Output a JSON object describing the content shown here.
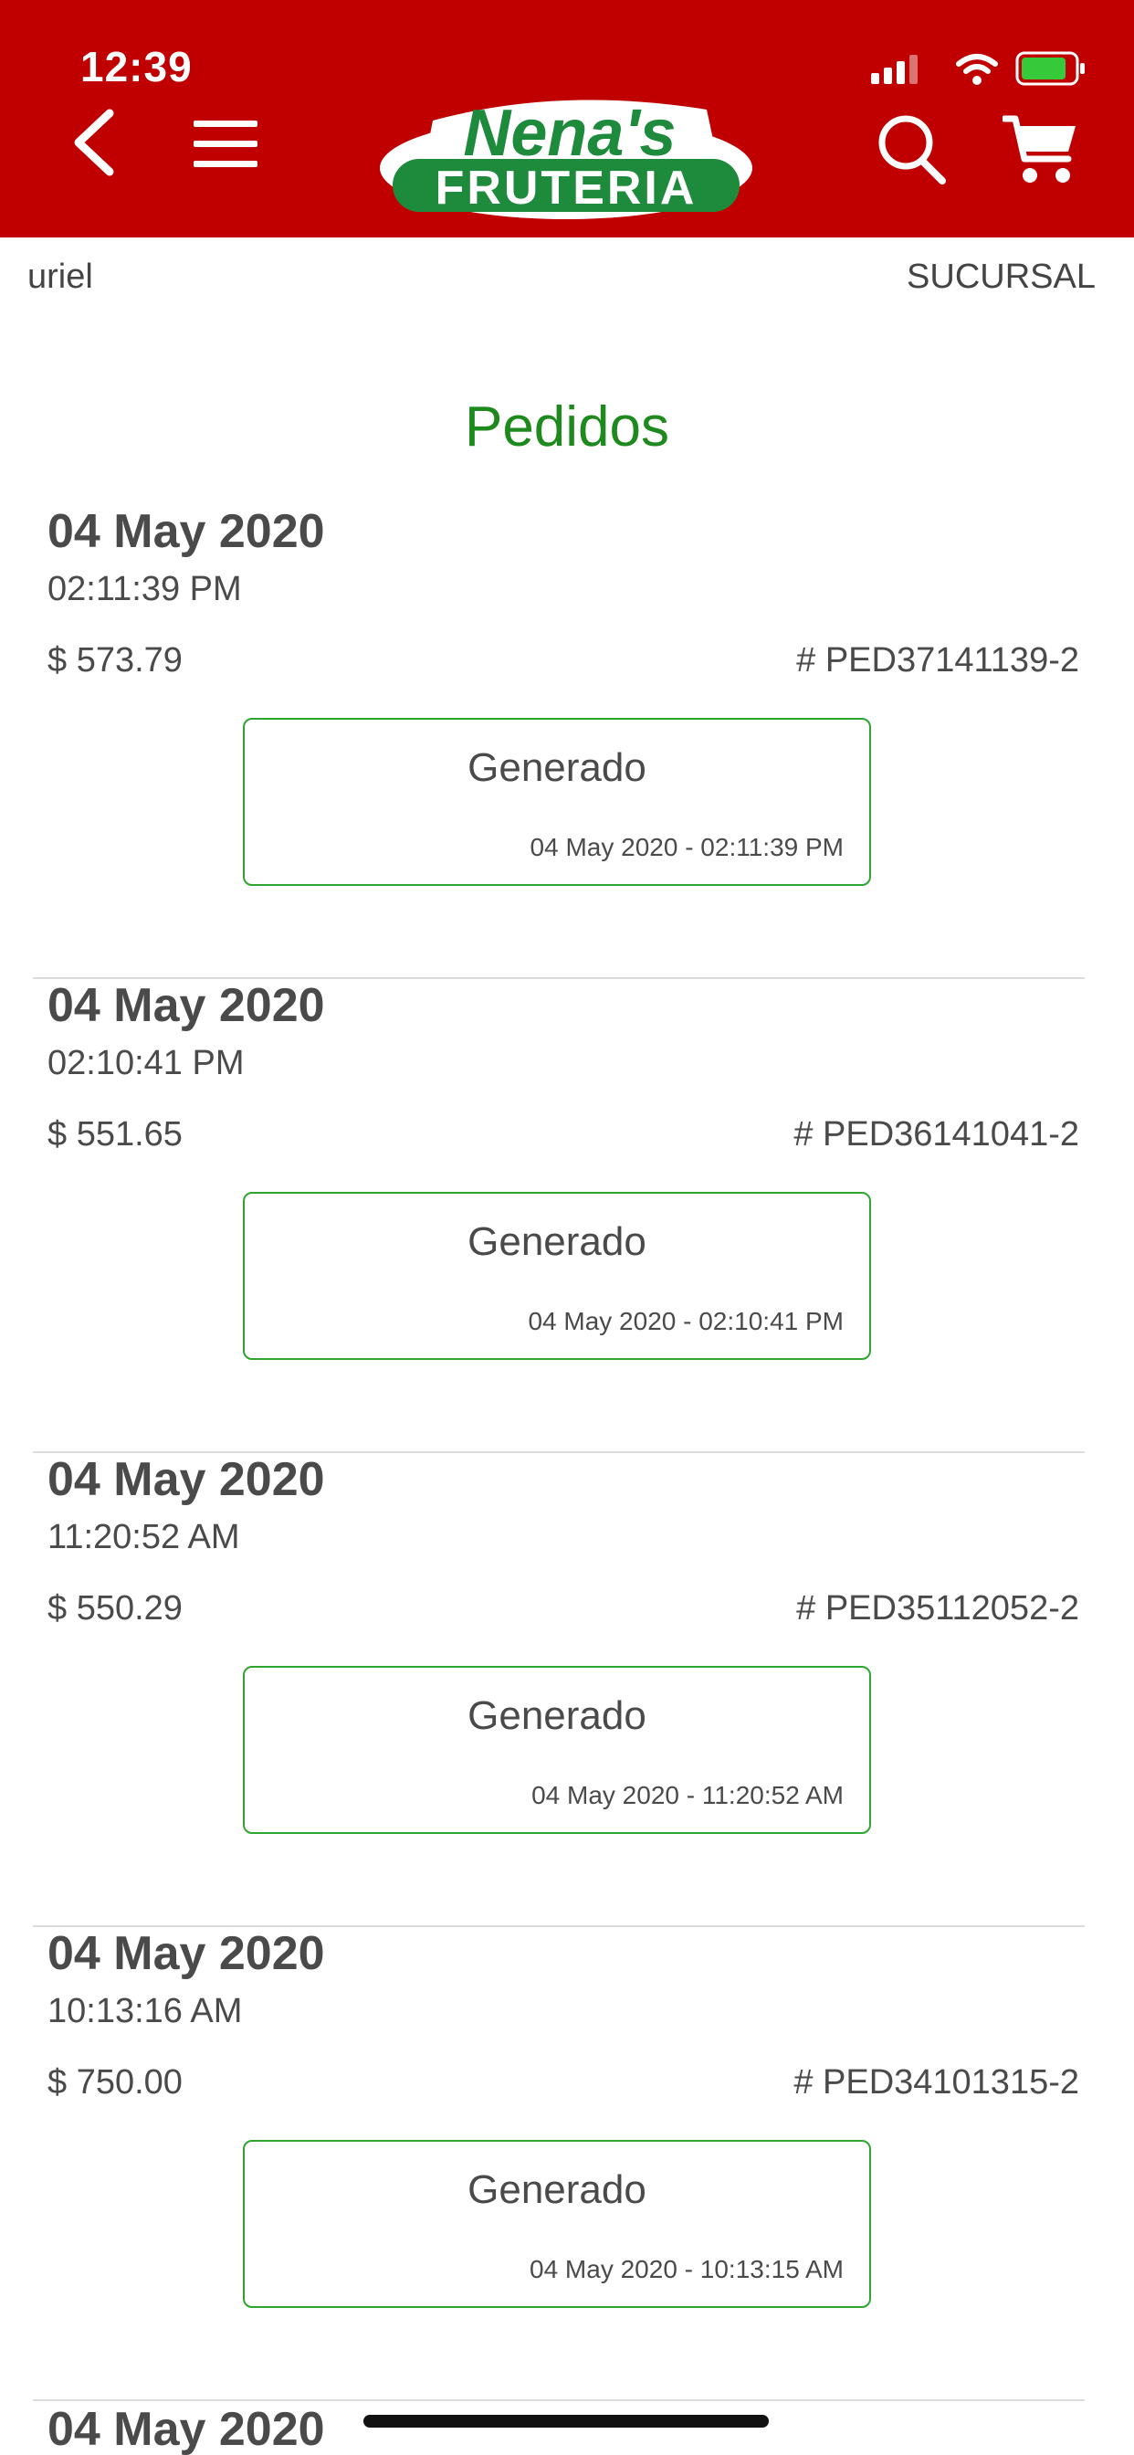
{
  "status_bar": {
    "time": "12:39"
  },
  "header": {
    "logo_line1": "Nena's",
    "logo_line2": "FRUTERIA",
    "colors": {
      "header_bg": "#c00000",
      "logo_green": "#1e8a3c"
    },
    "icons": [
      "back-icon",
      "menu-icon",
      "search-icon",
      "cart-icon"
    ]
  },
  "subbar": {
    "user": "uriel",
    "branch": "SUCURSAL"
  },
  "page": {
    "title": "Pedidos",
    "title_color": "#1e8a1e"
  },
  "orders": [
    {
      "date": "04 May 2020",
      "time": "02:11:39 PM",
      "amount": "$ 573.79",
      "code": "# PED37141139-2",
      "status": "Generado",
      "stamp": "04 May 2020 - 02:11:39 PM"
    },
    {
      "date": "04 May 2020",
      "time": "02:10:41 PM",
      "amount": "$ 551.65",
      "code": "# PED36141041-2",
      "status": "Generado",
      "stamp": "04 May 2020 - 02:10:41 PM"
    },
    {
      "date": "04 May 2020",
      "time": "11:20:52 AM",
      "amount": "$ 550.29",
      "code": "# PED35112052-2",
      "status": "Generado",
      "stamp": "04 May 2020 - 11:20:52 AM"
    },
    {
      "date": "04 May 2020",
      "time": "10:13:16 AM",
      "amount": "$ 750.00",
      "code": "# PED34101315-2",
      "status": "Generado",
      "stamp": "04 May 2020 - 10:13:15 AM"
    },
    {
      "date": "04 May 2020"
    }
  ],
  "status_color": "#2fa52f"
}
